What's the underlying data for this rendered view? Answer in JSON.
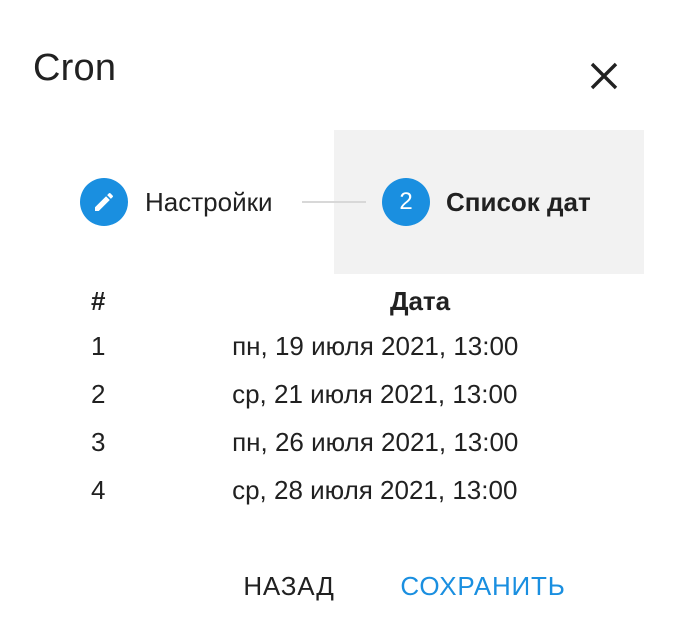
{
  "dialog": {
    "title": "Cron",
    "close_icon": "close-icon"
  },
  "stepper": {
    "steps": [
      {
        "indicator_icon": "pencil-icon",
        "label": "Настройки",
        "state": "completed"
      },
      {
        "indicator": "2",
        "label": "Список дат",
        "state": "active"
      }
    ],
    "colors": {
      "accent": "#1a8fe0",
      "active_background": "#f2f2f2",
      "connector": "#d8d8d8"
    }
  },
  "table": {
    "headers": {
      "number": "#",
      "date": "Дата"
    },
    "rows": [
      {
        "number": "1",
        "date": "пн, 19 июля 2021, 13:00"
      },
      {
        "number": "2",
        "date": "ср, 21 июля 2021, 13:00"
      },
      {
        "number": "3",
        "date": "пн, 26 июля 2021, 13:00"
      },
      {
        "number": "4",
        "date": "ср, 28 июля 2021, 13:00"
      }
    ]
  },
  "actions": {
    "back_label": "НАЗАД",
    "save_label": "СОХРАНИТЬ",
    "save_color": "#1a8fe0"
  }
}
